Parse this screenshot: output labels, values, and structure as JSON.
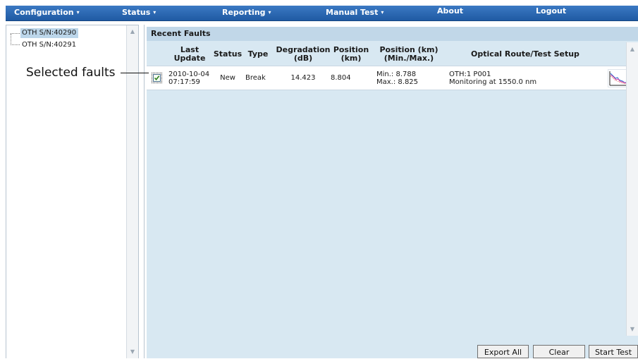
{
  "menu": {
    "items": [
      {
        "label": "Configuration",
        "caret": "▾"
      },
      {
        "label": "Status",
        "caret": "▾"
      },
      {
        "label": "Reporting",
        "caret": "▾"
      },
      {
        "label": "Manual Test",
        "caret": "▾"
      },
      {
        "label": "About",
        "caret": ""
      },
      {
        "label": "Logout",
        "caret": ""
      }
    ]
  },
  "tree": {
    "nodes": [
      {
        "label": "OTH S/N:40290",
        "selected": true
      },
      {
        "label": "OTH S/N:40291",
        "selected": false
      }
    ]
  },
  "recent_faults": {
    "title": "Recent Faults",
    "columns": {
      "last_update": "Last Update",
      "status": "Status",
      "type": "Type",
      "degradation": "Degradation (dB)",
      "position": "Position (km)",
      "position_range": "Position (km) (Min./Max.)",
      "route": "Optical Route/Test Setup"
    },
    "rows": [
      {
        "checked": true,
        "date": "2010-10-04",
        "time": "07:17:59",
        "status": "New",
        "type": "Break",
        "degradation": "14.423",
        "position": "8.804",
        "min": "Min.: 8.788",
        "max": "Max.: 8.825",
        "route_line1": "OTH:1 P001",
        "route_line2": "Monitoring at 1550.0 nm",
        "icon": "otdr-trace-icon"
      }
    ]
  },
  "buttons": {
    "export_all": "Export All",
    "clear": "Clear",
    "start_test": "Start Test"
  },
  "callout": {
    "text": "Selected faults"
  },
  "colors": {
    "menu_bar": "#2a66b0",
    "panel_background": "#d8e8f2",
    "section_header": "#c1d7e8",
    "tree_selection": "#bcd6ea"
  }
}
